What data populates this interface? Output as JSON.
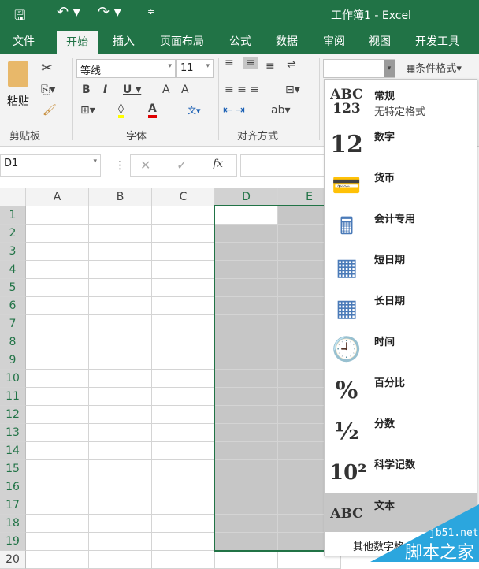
{
  "title": "工作簿1 - Excel",
  "tabs": [
    "文件",
    "开始",
    "插入",
    "页面布局",
    "公式",
    "数据",
    "审阅",
    "视图",
    "开发工具"
  ],
  "ribbon": {
    "paste": "粘贴",
    "font_name": "等线",
    "font_size": "11",
    "groups": [
      "剪贴板",
      "字体",
      "对齐方式"
    ],
    "number_format_value": "",
    "cond_format": "条件格式",
    "fill_color": "#ffff00",
    "font_color": "#e00000"
  },
  "formula_bar": {
    "name_box": "D1",
    "formula": ""
  },
  "columns": [
    "A",
    "B",
    "C",
    "D",
    "E"
  ],
  "rows": [
    "1",
    "2",
    "3",
    "4",
    "5",
    "6",
    "7",
    "8",
    "9",
    "10",
    "11",
    "12",
    "13",
    "14",
    "15",
    "16",
    "17",
    "18",
    "19",
    "20"
  ],
  "selection": "D1:E19",
  "menu": {
    "items": [
      {
        "icon": "ABC\n123",
        "label": "常规",
        "sub": "无特定格式"
      },
      {
        "icon": "12",
        "label": "数字"
      },
      {
        "icon": "currency",
        "label": "货币"
      },
      {
        "icon": "accounting",
        "label": "会计专用"
      },
      {
        "icon": "calendar",
        "label": "短日期"
      },
      {
        "icon": "calendar",
        "label": "长日期"
      },
      {
        "icon": "clock",
        "label": "时间"
      },
      {
        "icon": "%",
        "label": "百分比"
      },
      {
        "icon": "½",
        "label": "分数"
      },
      {
        "icon": "10²",
        "label": "科学记数"
      },
      {
        "icon": "ABC",
        "label": "文本"
      }
    ],
    "more": "其他数字格式..."
  },
  "watermark": {
    "url": "jb51.net",
    "name": "脚本之家"
  }
}
